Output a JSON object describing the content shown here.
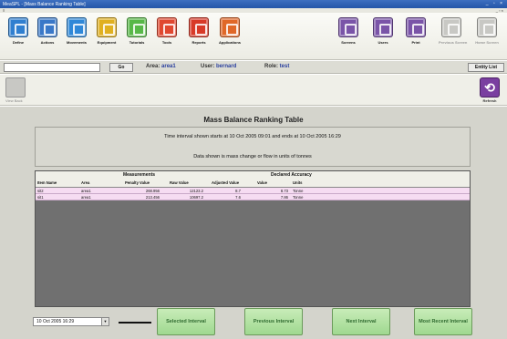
{
  "window": {
    "title": "MeaSPL - [Mass Balance Ranking Table]",
    "controls": "_ ▫ ×",
    "menu_left": "≡",
    "menu_right": "_ ▫ ×"
  },
  "toolbar": {
    "buttons": [
      {
        "label": "Define",
        "icon": "define-icon",
        "color": "#2f7fd0"
      },
      {
        "label": "Actions",
        "icon": "actions-icon",
        "color": "#3a78c8"
      },
      {
        "label": "Movements",
        "icon": "movements-icon",
        "color": "#2f88d8"
      },
      {
        "label": "Equipment",
        "icon": "equipment-icon",
        "color": "#e0b020"
      },
      {
        "label": "Tutorials",
        "icon": "tutorials-icon",
        "color": "#58b848"
      },
      {
        "label": "Tools",
        "icon": "tools-icon",
        "color": "#e04830"
      },
      {
        "label": "Reports",
        "icon": "reports-icon",
        "color": "#d83a28"
      },
      {
        "label": "Applications",
        "icon": "applications-icon",
        "color": "#e06828"
      },
      {
        "label": "Screens",
        "icon": "screens-icon",
        "color": "#7a54a8"
      },
      {
        "label": "Users",
        "icon": "users-icon",
        "color": "#7a54a8"
      },
      {
        "label": "Print",
        "icon": "print-icon",
        "color": "#7a54a8"
      },
      {
        "label": "Previous Screen",
        "icon": "previous-screen-icon",
        "color": "#c8c8c4"
      },
      {
        "label": "Home Screen",
        "icon": "home-screen-icon",
        "color": "#c8c8c4"
      }
    ]
  },
  "loginbar": {
    "user_input_value": "",
    "go_label": "Go",
    "area_label": "Area:",
    "area_value": "area1",
    "user_label": "User:",
    "user_value": "bernard",
    "role_label": "Role:",
    "role_value": "test",
    "entity_list_label": "Entity List"
  },
  "subbar": {
    "view_label": "View Back",
    "refresh_label": "Refresh"
  },
  "main": {
    "title": "Mass Balance Ranking Table",
    "time_interval_text": "Time interval shown starts at 10 Oct 2005 09:01 and ends at 10 Oct 2005 16:29",
    "data_shown_text": "Data shown is mass change or flow in units of tonnes"
  },
  "table": {
    "groups": [
      "Measurements",
      "Declared Accuracy"
    ],
    "columns": [
      "Item Name",
      "Area",
      "Penalty Value",
      "Raw Value",
      "Adjusted Value",
      "Value",
      "Units"
    ],
    "rows": [
      [
        "sit2",
        "area1",
        "268.956",
        "12123.2",
        "8.7",
        "8.73",
        "Tonne"
      ],
      [
        "sit1",
        "area1",
        "213.456",
        "10697.2",
        "7.6",
        "7.86",
        "Tonne"
      ]
    ]
  },
  "bottom": {
    "date_value": "10 Oct 2005 16:29",
    "selected_interval_label": "Selected Interval",
    "previous_interval_label": "Previous Interval",
    "next_interval_label": "Next Interval",
    "most_recent_interval_label": "Most Recent Interval"
  }
}
